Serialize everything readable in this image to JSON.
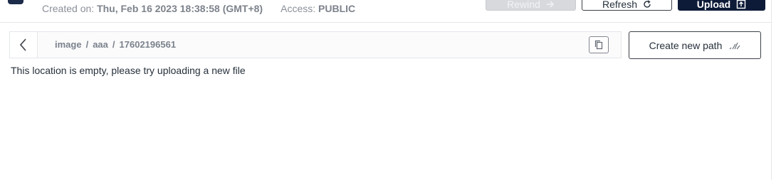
{
  "header": {
    "created_label": "Created on:",
    "created_value": "Thu, Feb 16 2023 18:38:58 (GMT+8)",
    "access_label": "Access:",
    "access_value": "PUBLIC",
    "rewind_label": "Rewind",
    "refresh_label": "Refresh",
    "upload_label": "Upload"
  },
  "path": {
    "segments": [
      "image",
      "aaa",
      "17602196561"
    ],
    "separator": "/"
  },
  "actions": {
    "create_path_label": "Create new path"
  },
  "content": {
    "empty_message": "This location is empty, please try uploading a new file"
  },
  "icons": {
    "back": "chevron-left-icon",
    "copy": "copy-icon",
    "new_path": "new-path-icon",
    "rewind": "arrow-right-icon",
    "refresh": "refresh-icon",
    "upload": "upload-icon"
  },
  "colors": {
    "primary": "#0d1b38",
    "border": "#e4e6ea",
    "disabled": "#d7d9dc"
  }
}
